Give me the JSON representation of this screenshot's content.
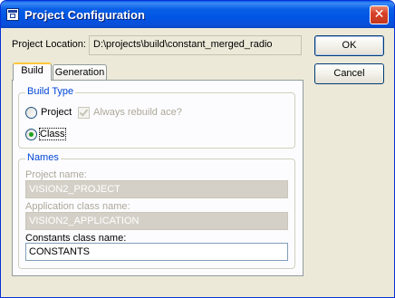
{
  "window": {
    "title": "Project Configuration",
    "close_glyph": "✕"
  },
  "project_location": {
    "label": "Project Location:",
    "value": "D:\\projects\\build\\constant_merged_radio"
  },
  "buttons": {
    "ok": "OK",
    "cancel": "Cancel"
  },
  "tabs": [
    {
      "label": "Build",
      "active": true
    },
    {
      "label": "Generation",
      "active": false
    }
  ],
  "build_type": {
    "title": "Build Type",
    "project_label": "Project",
    "always_rebuild_label": "Always rebuild ace?",
    "always_rebuild_checked": true,
    "class_label": "Class",
    "selected": "Class"
  },
  "names": {
    "title": "Names",
    "project_name_label": "Project name:",
    "project_name_value": "VISION2_PROJECT",
    "application_class_label": "Application class name:",
    "application_class_value": "VISION2_APPLICATION",
    "constants_class_label": "Constants class name:",
    "constants_class_value": "CONSTANTS"
  },
  "colors": {
    "title_bar": "#0055e5",
    "group_title": "#0046d5",
    "tab_highlight": "#ffc83c",
    "radio_dot": "#21a121"
  }
}
